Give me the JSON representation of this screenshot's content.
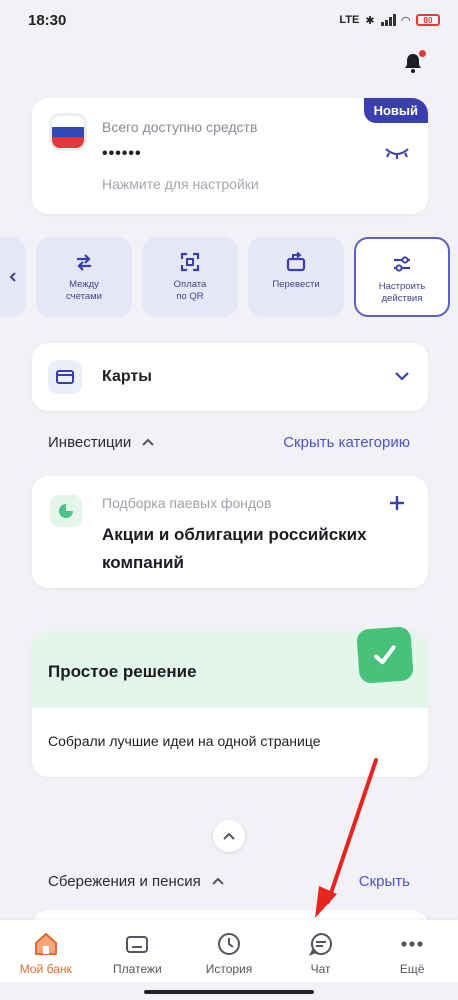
{
  "status_bar": {
    "time": "18:30",
    "network": "LTE",
    "battery": "80"
  },
  "balance_card": {
    "badge": "Новый",
    "label": "Всего доступно средств",
    "value": "••••••",
    "hint": "Нажмите для настройки"
  },
  "actions": [
    {
      "label": "Между\nсчетами",
      "icon": "arrows-swap-icon"
    },
    {
      "label": "Оплата\nпо QR",
      "icon": "qr-scan-icon"
    },
    {
      "label": "Перевести",
      "icon": "transfer-icon"
    },
    {
      "label": "Настроить\nдействия",
      "icon": "sliders-icon"
    }
  ],
  "cards_section": {
    "label": "Карты"
  },
  "investments": {
    "title": "Инвестиции",
    "link": "Скрыть категорию",
    "fund_sub": "Подборка паевых фондов",
    "fund_title": "Акции и облигации российских компаний"
  },
  "simple_solution": {
    "title": "Простое решение",
    "text": "Собрали лучшие идеи на одной странице"
  },
  "savings": {
    "title": "Сбережения и пенсия",
    "link": "Скрыть"
  },
  "bottom_nav": [
    {
      "label": "Мой банк",
      "active": true
    },
    {
      "label": "Платежи",
      "active": false
    },
    {
      "label": "История",
      "active": false
    },
    {
      "label": "Чат",
      "active": false
    },
    {
      "label": "Ещё",
      "active": false
    }
  ],
  "colors": {
    "accent": "#4a55c8",
    "active_nav": "#e36a2c",
    "badge": "#3a3fb0",
    "annotation_arrow": "#e8241f"
  }
}
